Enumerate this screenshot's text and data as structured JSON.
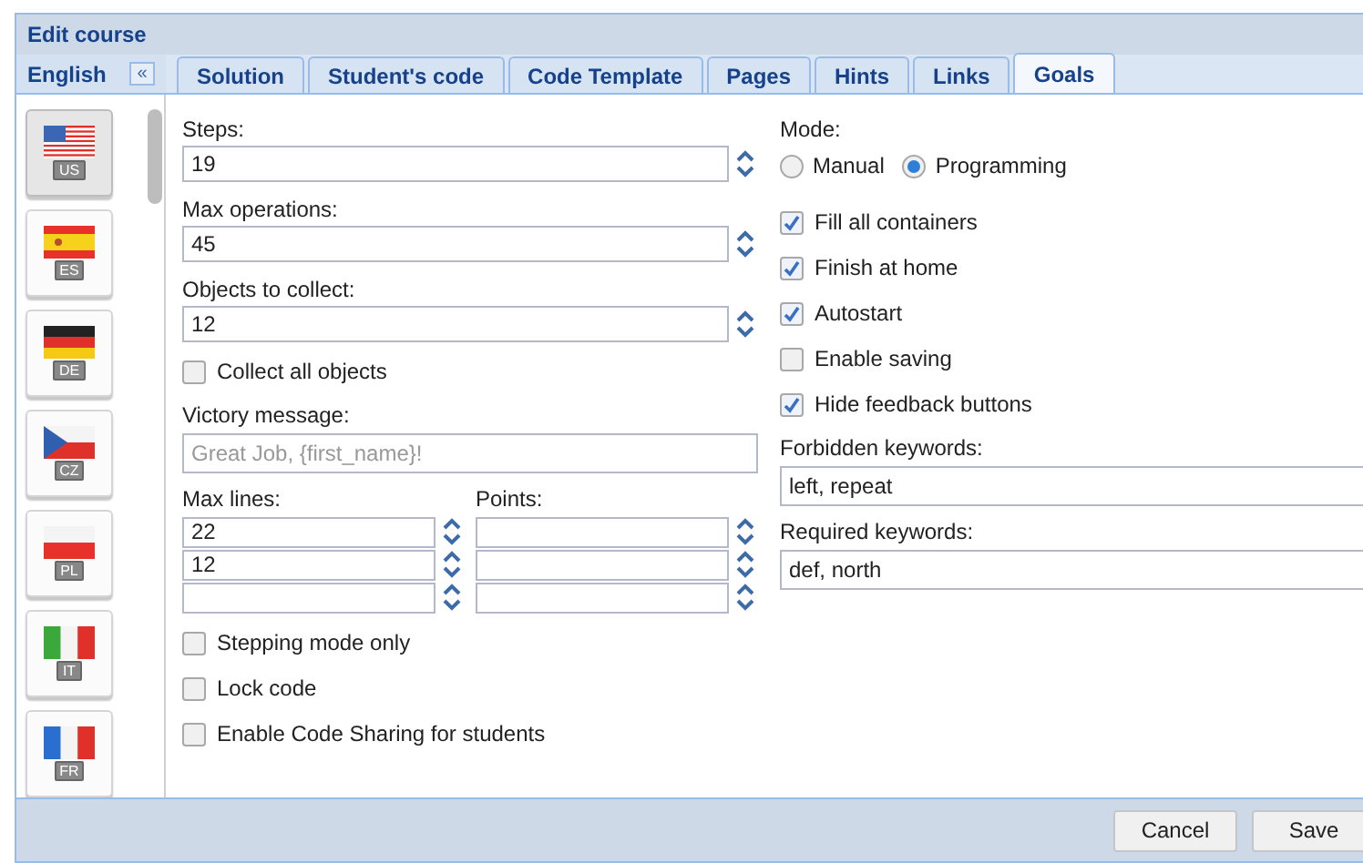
{
  "dialog": {
    "title": "Edit course"
  },
  "language_panel": {
    "title": "English",
    "collapse": "«",
    "flags": [
      {
        "code": "US",
        "kind": "us",
        "selected": true
      },
      {
        "code": "ES",
        "kind": "es",
        "selected": false
      },
      {
        "code": "DE",
        "kind": "de",
        "selected": false
      },
      {
        "code": "CZ",
        "kind": "cz",
        "selected": false
      },
      {
        "code": "PL",
        "kind": "pl",
        "selected": false
      },
      {
        "code": "IT",
        "kind": "it",
        "selected": false
      },
      {
        "code": "FR",
        "kind": "fr",
        "selected": false
      }
    ]
  },
  "tabs": [
    {
      "label": "Solution",
      "selected": false
    },
    {
      "label": "Student's code",
      "selected": false
    },
    {
      "label": "Code Template",
      "selected": false
    },
    {
      "label": "Pages",
      "selected": false
    },
    {
      "label": "Hints",
      "selected": false
    },
    {
      "label": "Links",
      "selected": false
    },
    {
      "label": "Goals",
      "selected": true
    }
  ],
  "left_column": [
    {
      "kind": "spinner",
      "label": "Steps:",
      "value": "19"
    },
    {
      "kind": "spinner",
      "label": "Max operations:",
      "value": "45"
    },
    {
      "kind": "spinner",
      "label": "Objects to collect:",
      "value": "12"
    },
    {
      "kind": "checkbox",
      "label": "Collect all objects",
      "checked": false
    },
    {
      "kind": "text",
      "label": "Victory message:",
      "placeholder": "Great Job, {first_name}!"
    },
    {
      "kind": "grid",
      "columns": [
        "Max lines:",
        "Points:"
      ],
      "rows": [
        {
          "max_lines": "22"
        },
        {
          "max_lines": "12"
        },
        {}
      ]
    },
    {
      "kind": "checkbox",
      "label": "Stepping mode only",
      "checked": false
    },
    {
      "kind": "checkbox",
      "label": "Lock code",
      "checked": false
    },
    {
      "kind": "checkbox",
      "label": "Enable Code Sharing for students",
      "checked": false
    }
  ],
  "right_column": [
    {
      "kind": "radio",
      "label": "Mode:",
      "options": [
        {
          "label": "Manual",
          "selected": false
        },
        {
          "label": "Programming",
          "selected": true
        }
      ]
    },
    {
      "kind": "checkbox",
      "label": "Fill all containers",
      "checked": true
    },
    {
      "kind": "checkbox",
      "label": "Finish at home",
      "checked": true
    },
    {
      "kind": "checkbox",
      "label": "Autostart",
      "checked": true
    },
    {
      "kind": "checkbox",
      "label": "Enable saving",
      "checked": false
    },
    {
      "kind": "checkbox",
      "label": "Hide feedback buttons",
      "checked": true
    },
    {
      "kind": "text",
      "label": "Forbidden keywords:",
      "value": "left, repeat"
    },
    {
      "kind": "text",
      "label": "Required keywords:",
      "value": "def, north"
    }
  ],
  "buttons": [
    {
      "label": "Cancel"
    },
    {
      "label": "Save"
    }
  ]
}
